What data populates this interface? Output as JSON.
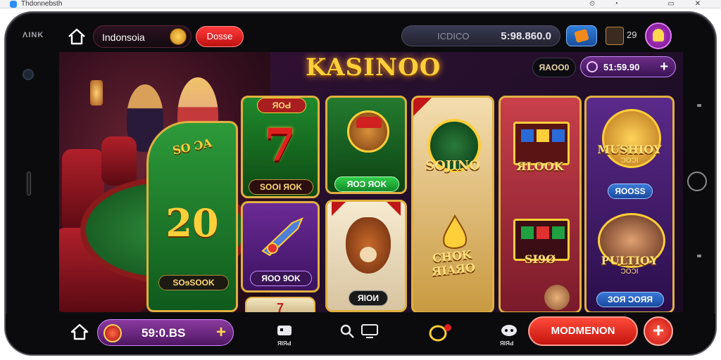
{
  "window": {
    "title": "Thdonnebsth",
    "controls": [
      "⏲",
      "◔",
      "▭",
      "✕"
    ]
  },
  "topbar": {
    "left_label": "ΛΙΝΚ",
    "region": "Indonsoia",
    "red_button": "Dosse",
    "search_placeholder": "ICDICO",
    "search_value": "5:98.860.0",
    "count": "29"
  },
  "hero": {
    "title": "KASINOO",
    "mini_pill": "ЯAOO0",
    "balance": "51:59.90",
    "balance_plus": "+"
  },
  "cards": {
    "c1_top": "ЯOԀ",
    "c2_top_label": "SOOI ЯOK",
    "c2_top_glyph": "7",
    "c2_bot_label": "ЯOO 9OK",
    "c1_mid_glyph": "20",
    "c1_mid_label": "SOɘSOOK",
    "c1_felt": "SO ƆA",
    "c3_top_label": "ЯOƆ ЯOK",
    "c3_bot_label": "ЯIOИ",
    "c4_top_label": "SOJINO",
    "c4_bot_label": "CHOK ЯIAЯO",
    "c5_top_label": "ЯLOOK",
    "c5_bot_label": "ЅI9Ø",
    "c6_top_label": "MUSHIOY",
    "c6_top_sub": "ƆOƆI",
    "c6_top_badge": "ЯOOЅS",
    "c6_bot_label": "PULTIOY",
    "c6_bot_sub": "ƆOƆI",
    "c6_bot_badge": "ЗOЯ ƆOЯЯ"
  },
  "bottombar": {
    "coins": "59:0.BS",
    "coins_plus": "+",
    "icon2_label": "ЯIЯԀ",
    "icon5_label": "ЯIЯԀ",
    "cta": "MODMENON",
    "cta_plus": "+"
  },
  "colors": {
    "accent_gold": "#ffcf3a",
    "purple": "#6a2d86",
    "red": "#c4140e",
    "green": "#1f7a2e"
  },
  "icons": [
    "home-icon",
    "coin-icon",
    "plus-icon",
    "search-icon",
    "monitor-icon",
    "notification-icon",
    "chat-icon",
    "gift-icon"
  ]
}
